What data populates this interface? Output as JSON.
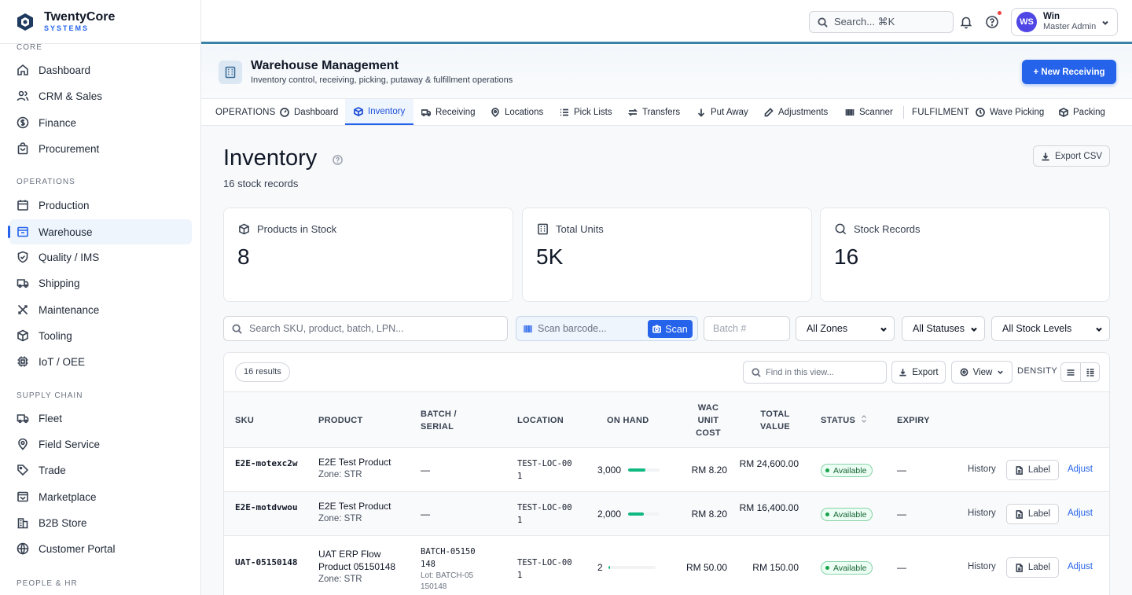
{
  "brand": {
    "name": "TwentyCore",
    "sub": "SYSTEMS"
  },
  "sidebar": {
    "sections": [
      {
        "label": "CORE"
      },
      {
        "label": "OPERATIONS"
      },
      {
        "label": "SUPPLY CHAIN"
      },
      {
        "label": "PEOPLE & HR"
      }
    ],
    "items": [
      {
        "label": "Dashboard",
        "icon": "home-icon"
      },
      {
        "label": "CRM & Sales",
        "icon": "users-icon"
      },
      {
        "label": "Finance",
        "icon": "dollar-icon"
      },
      {
        "label": "Procurement",
        "icon": "bag-icon"
      },
      {
        "label": "Production",
        "icon": "calendar-icon"
      },
      {
        "label": "Warehouse",
        "icon": "warehouse-icon",
        "active": true
      },
      {
        "label": "Quality / IMS",
        "icon": "shield-check-icon"
      },
      {
        "label": "Shipping",
        "icon": "truck-icon"
      },
      {
        "label": "Maintenance",
        "icon": "tools-icon"
      },
      {
        "label": "Tooling",
        "icon": "box-icon"
      },
      {
        "label": "IoT / OEE",
        "icon": "chip-icon"
      },
      {
        "label": "Fleet",
        "icon": "truck-icon"
      },
      {
        "label": "Field Service",
        "icon": "map-pin-icon"
      },
      {
        "label": "Trade",
        "icon": "tag-icon"
      },
      {
        "label": "Marketplace",
        "icon": "store-icon"
      },
      {
        "label": "B2B Store",
        "icon": "building-icon"
      },
      {
        "label": "Customer Portal",
        "icon": "globe-icon"
      }
    ]
  },
  "topbar": {
    "search_placeholder": "Search... ⌘K",
    "user": {
      "initials": "WS",
      "name": "Win",
      "role": "Master Admin"
    }
  },
  "module": {
    "title": "Warehouse Management",
    "subtitle": "Inventory control, receiving, picking, putaway & fulfillment operations",
    "new_button": "+ New Receiving"
  },
  "tabs": {
    "group_operations": "OPERATIONS",
    "group_fulfilment": "FULFILMENT",
    "items": [
      {
        "label": "Dashboard"
      },
      {
        "label": "Inventory",
        "active": true
      },
      {
        "label": "Receiving"
      },
      {
        "label": "Locations"
      },
      {
        "label": "Pick Lists"
      },
      {
        "label": "Transfers"
      },
      {
        "label": "Put Away"
      },
      {
        "label": "Adjustments"
      },
      {
        "label": "Scanner"
      },
      {
        "label": "Wave Picking"
      },
      {
        "label": "Packing"
      }
    ]
  },
  "page": {
    "title": "Inventory",
    "subtitle": "16 stock records",
    "export_csv": "Export CSV"
  },
  "stats": [
    {
      "label": "Products in Stock",
      "value": "8",
      "icon": "box-icon"
    },
    {
      "label": "Total Units",
      "value": "5K",
      "icon": "building-icon"
    },
    {
      "label": "Stock Records",
      "value": "16",
      "icon": "search-icon"
    }
  ],
  "filters": {
    "search_placeholder": "Search SKU, product, batch, LPN...",
    "scan_placeholder": "Scan barcode...",
    "scan_button": "Scan",
    "batch_placeholder": "Batch #",
    "zones": "All Zones",
    "statuses": "All Statuses",
    "stock_levels": "All Stock Levels"
  },
  "table": {
    "results": "16 results",
    "find_placeholder": "Find in this view...",
    "export": "Export",
    "view": "View",
    "density": "DENSITY",
    "columns": {
      "sku": "SKU",
      "product": "PRODUCT",
      "batch": "BATCH / SERIAL",
      "location": "LOCATION",
      "on_hand": "ON HAND",
      "wac": "WAC UNIT COST",
      "total": "TOTAL VALUE",
      "status": "STATUS",
      "expiry": "EXPIRY"
    },
    "rows": [
      {
        "sku": "E2E-motexc2w",
        "product": "E2E Test Product",
        "zone": "Zone: STR",
        "batch": "—",
        "lot": "",
        "location": "TEST-LOC-001",
        "on_hand": "3,000",
        "level": 0.55,
        "wac": "RM 8.20",
        "total": "RM 24,600.00",
        "status": "Available",
        "expiry": "—",
        "history": "History",
        "label": "Label",
        "adjust": "Adjust"
      },
      {
        "sku": "E2E-motdvwou",
        "product": "E2E Test Product",
        "zone": "Zone: STR",
        "batch": "—",
        "lot": "",
        "location": "TEST-LOC-001",
        "on_hand": "2,000",
        "level": 0.5,
        "wac": "RM 8.20",
        "total": "RM 16,400.00",
        "status": "Available",
        "expiry": "—",
        "history": "History",
        "label": "Label",
        "adjust": "Adjust"
      },
      {
        "sku": "UAT-05150148",
        "product": "UAT ERP Flow Product 05150148",
        "zone": "Zone: STR",
        "batch": "BATCH-05150148",
        "lot": "Lot: BATCH-05150148",
        "location": "TEST-LOC-001",
        "on_hand": "2",
        "level": 0.03,
        "wac": "RM 50.00",
        "total": "RM 150.00",
        "status": "Available",
        "expiry": "—",
        "history": "History",
        "label": "Label",
        "adjust": "Adjust"
      }
    ]
  },
  "colors": {
    "accent": "#2563eb",
    "success": "#10b981",
    "topbar_rule": "#3b82a8"
  }
}
